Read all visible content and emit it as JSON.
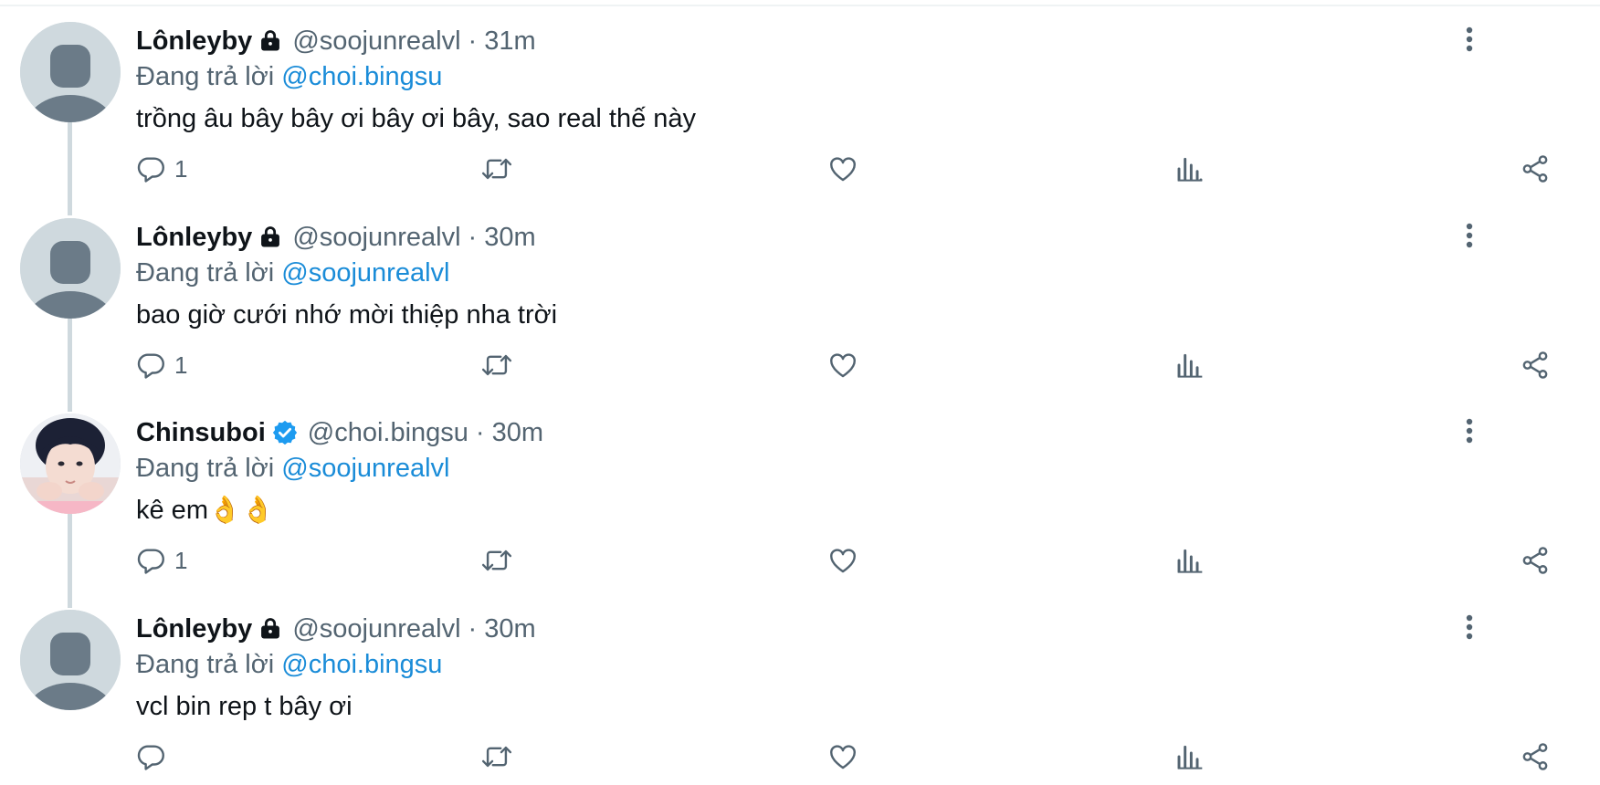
{
  "tweets": [
    {
      "display_name": "Lônleyby",
      "badge": "lock-icon",
      "handle": "@soojunrealvl",
      "separator": "·",
      "time": "31m",
      "reply_prefix": "Đang trả lời",
      "reply_to": "@choi.bingsu",
      "text": "trồng âu bây bây ơi bây ơi bây, sao real thế này",
      "reply_count": "1"
    },
    {
      "display_name": "Lônleyby",
      "badge": "lock-icon",
      "handle": "@soojunrealvl",
      "separator": "·",
      "time": "30m",
      "reply_prefix": "Đang trả lời",
      "reply_to": "@soojunrealvl",
      "text": "bao giờ cưới nhớ mời thiệp nha trời",
      "reply_count": "1"
    },
    {
      "display_name": "Chinsuboi",
      "badge": "verified-icon",
      "handle": "@choi.bingsu",
      "separator": "·",
      "time": "30m",
      "reply_prefix": "Đang trả lời",
      "reply_to": "@soojunrealvl",
      "text": "kê em👌👌",
      "reply_count": "1"
    },
    {
      "display_name": "Lônleyby",
      "badge": "lock-icon",
      "handle": "@soojunrealvl",
      "separator": "·",
      "time": "30m",
      "reply_prefix": "Đang trả lời",
      "reply_to": "@choi.bingsu",
      "text": "vcl bin rep t bây ơi",
      "reply_count": ""
    }
  ],
  "colors": {
    "text_primary": "#0f1419",
    "text_secondary": "#536471",
    "mention": "#1a8cd8",
    "verified": "#1d9bf0",
    "avatar_placeholder": "#cfd9de",
    "thread_line": "#cfd9de"
  },
  "icons": {
    "reply": "reply-icon",
    "retweet": "retweet-icon",
    "like": "heart-icon",
    "views": "analytics-icon",
    "share": "share-icon",
    "more": "more-vertical-icon"
  }
}
